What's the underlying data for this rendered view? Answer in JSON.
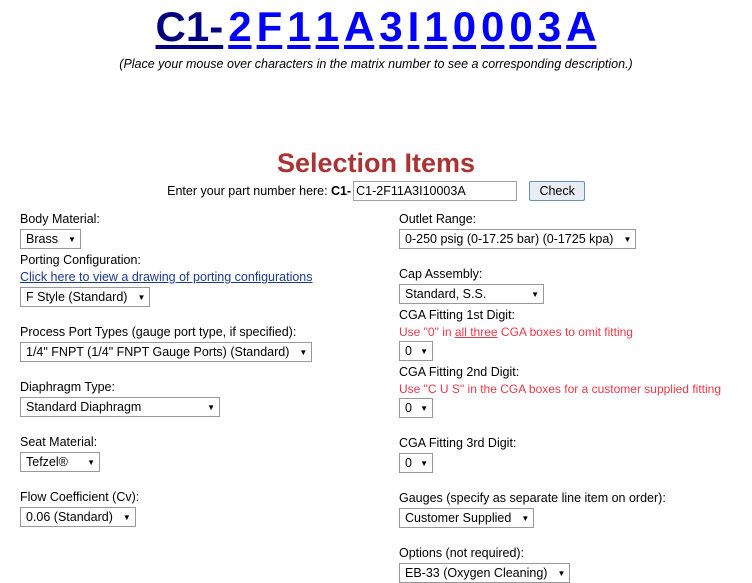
{
  "header": {
    "matrix_prefix": "C1-",
    "matrix_chars": [
      "2",
      "F",
      "1",
      "1",
      "A",
      "3",
      "I",
      "1",
      "0",
      "0",
      "0",
      "3",
      "A"
    ],
    "hint": "(Place your mouse over characters in the matrix number to see a corresponding description.)",
    "prefix_color": "#000080",
    "char_color": "#0000FF"
  },
  "selection": {
    "heading": "Selection Items",
    "heading_color": "#AA3333",
    "entry_label": "Enter your part number here:",
    "entry_prefix": "C1-",
    "entry_value": "C1-2F11A3I10003A",
    "entry_placeholder": "",
    "check_label": "Check"
  },
  "left_column": [
    {
      "label": "Body Material:",
      "value": "Brass"
    },
    {
      "label": "Porting Configuration:",
      "link": "Click here to view a drawing of porting configurations",
      "value": "F Style (Standard)"
    },
    {
      "label": "Process Port Types (gauge port type, if specified):",
      "value": "1/4\" FNPT (1/4\" FNPT Gauge Ports) (Standard)"
    },
    {
      "label": "Diaphragm Type:",
      "value": "Standard Diaphragm"
    },
    {
      "label": "Seat Material:",
      "value": "Tefzel®"
    },
    {
      "label": "Flow Coefficient (Cv):",
      "value": "0.06 (Standard)"
    }
  ],
  "right_column": [
    {
      "label": "Outlet Range:",
      "value": "0-250 psig (0-17.25 bar) (0-1725 kpa)"
    },
    {
      "label": "Cap Assembly:",
      "value": "Standard, S.S."
    },
    {
      "label": "CGA Fitting 1st Digit:",
      "hint_pre": "Use \"0\" in ",
      "hint_underline": "all three",
      "hint_post": " CGA boxes to omit fitting",
      "value": "0"
    },
    {
      "label": "CGA Fitting 2nd Digit:",
      "hint_pre": "Use \"C U S\" in the CGA boxes for a customer supplied fitting",
      "value": "0"
    },
    {
      "label": "CGA Fitting 3rd Digit:",
      "value": "0"
    },
    {
      "label": "Gauges (specify as separate line item on order):",
      "value": "Customer Supplied"
    },
    {
      "label": "Options (not required):",
      "value": "EB-33 (Oxygen Cleaning)"
    }
  ],
  "icons": {
    "dropdown_arrow": "▼"
  },
  "hint_color": "#E8384A",
  "link_color": "#1A3A8F"
}
